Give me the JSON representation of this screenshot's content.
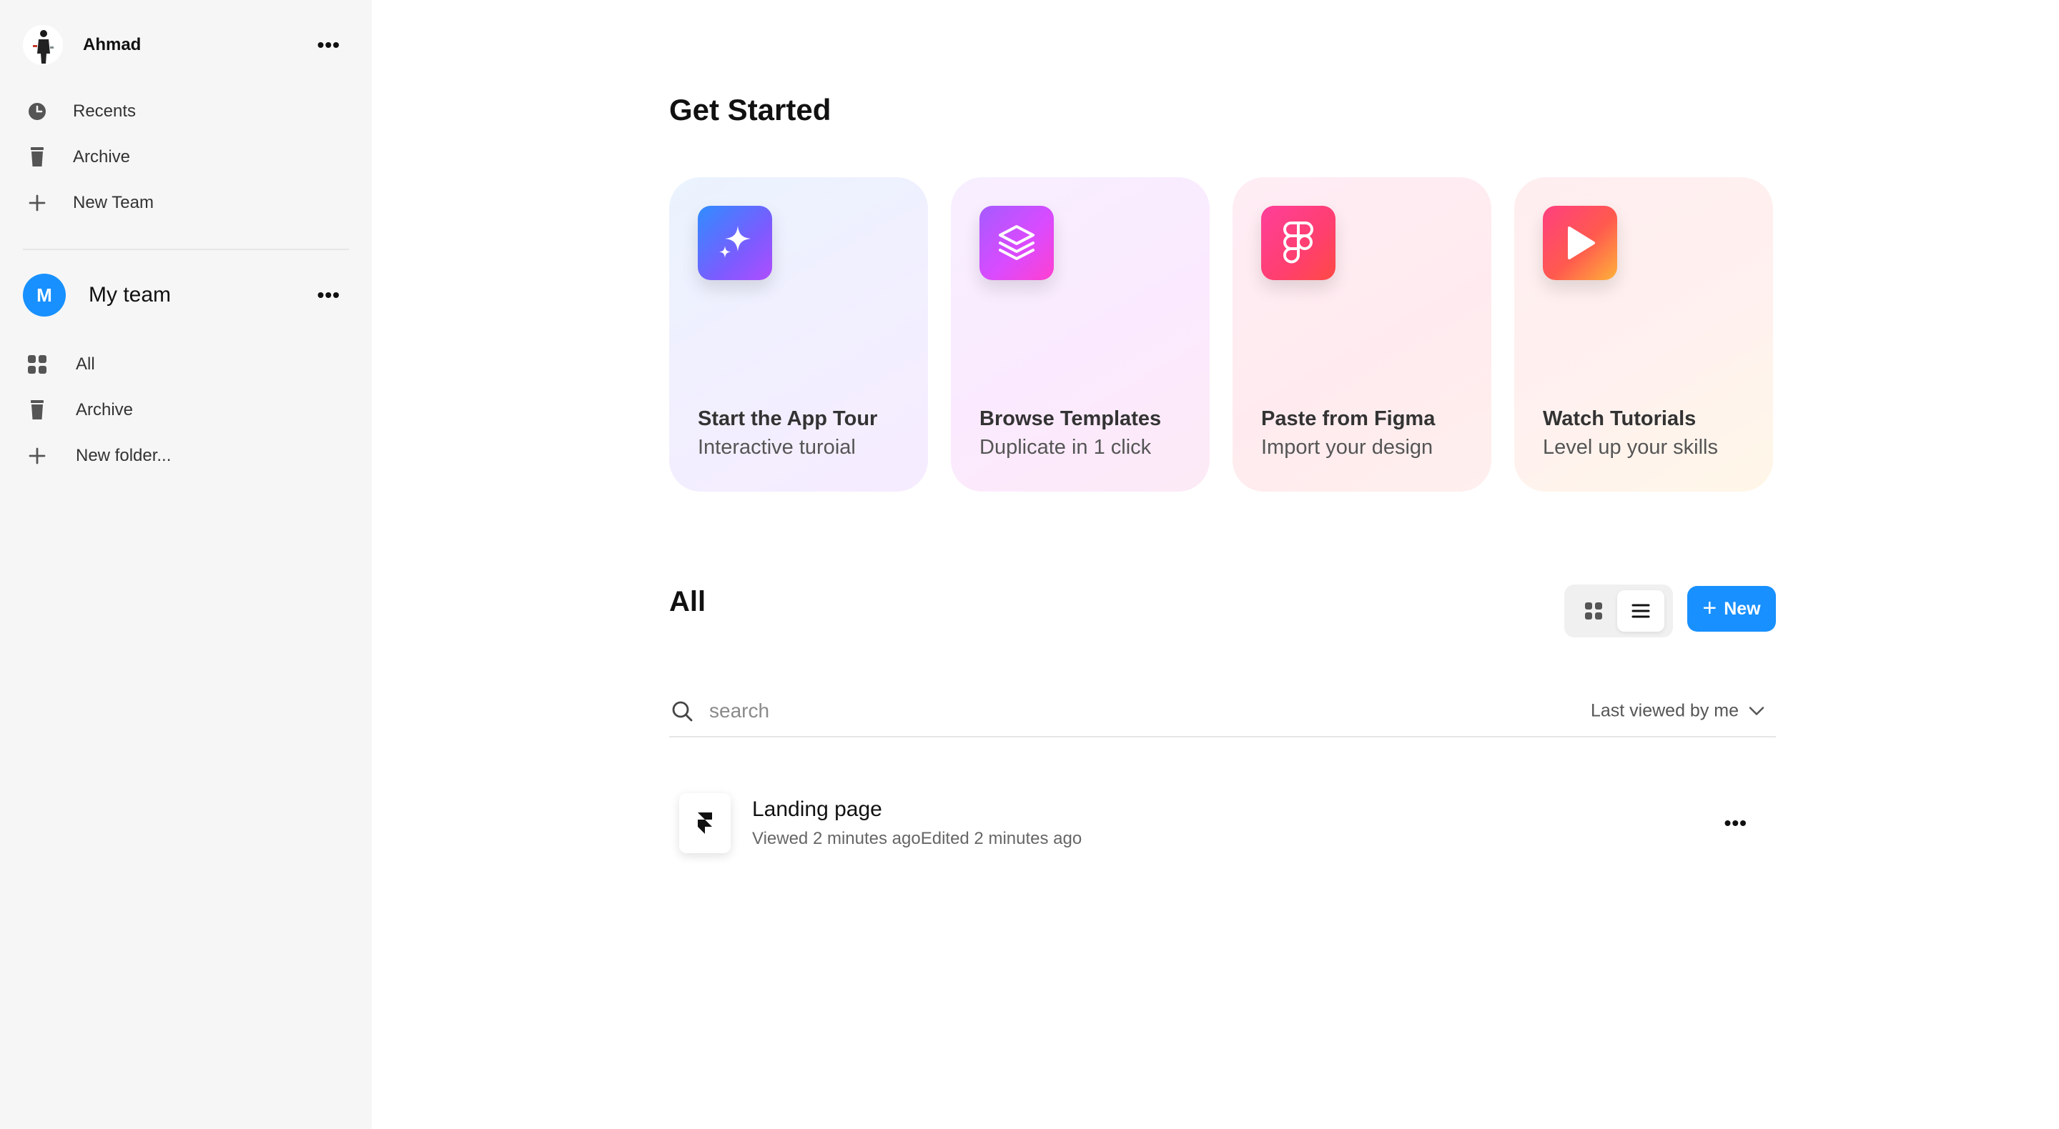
{
  "user": {
    "name": "Ahmad"
  },
  "sidebar": {
    "items": [
      {
        "label": "Recents",
        "icon": "clock-icon"
      },
      {
        "label": "Archive",
        "icon": "trash-icon"
      },
      {
        "label": "New Team",
        "icon": "plus-icon"
      }
    ],
    "team": {
      "initial": "M",
      "name": "My team",
      "items": [
        {
          "label": "All",
          "icon": "grid-icon"
        },
        {
          "label": "Archive",
          "icon": "trash-icon"
        },
        {
          "label": "New folder...",
          "icon": "plus-icon"
        }
      ]
    }
  },
  "main": {
    "get_started_title": "Get Started",
    "cards": [
      {
        "title": "Start the App Tour",
        "subtitle": "Interactive turoial",
        "icon": "sparkle-icon"
      },
      {
        "title": "Browse Templates",
        "subtitle": "Duplicate in 1 click",
        "icon": "layers-icon"
      },
      {
        "title": "Paste from Figma",
        "subtitle": "Import your design",
        "icon": "figma-icon"
      },
      {
        "title": "Watch Tutorials",
        "subtitle": "Level up your skills",
        "icon": "play-icon"
      }
    ],
    "all_title": "All",
    "new_button": "New",
    "search": {
      "placeholder": "search",
      "value": ""
    },
    "sort": {
      "selected": "Last viewed by me"
    },
    "files": [
      {
        "name": "Landing page",
        "meta": "Viewed 2 minutes agoEdited 2 minutes ago"
      }
    ]
  },
  "colors": {
    "accent": "#1890ff",
    "sidebar_bg": "#f6f6f6"
  }
}
